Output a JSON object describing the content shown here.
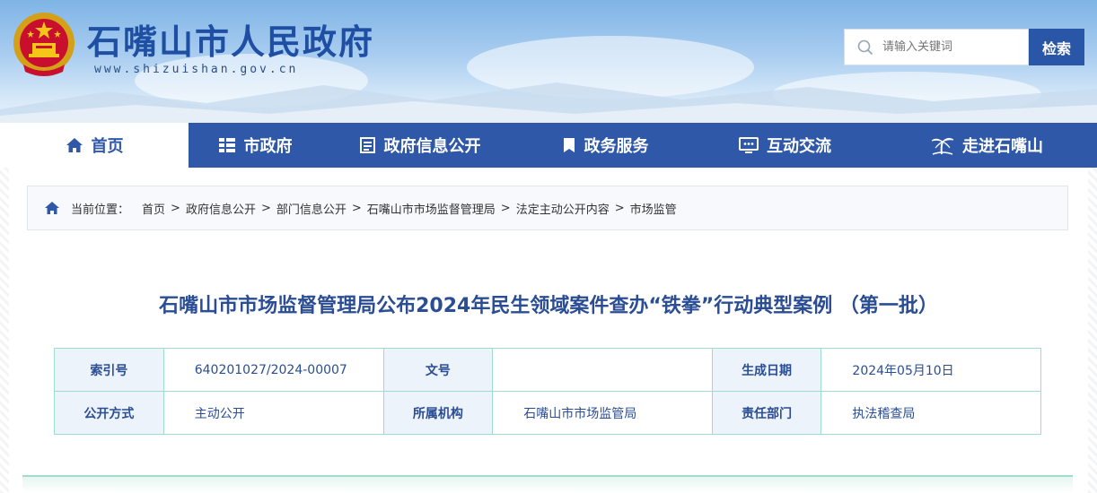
{
  "header": {
    "site_title": "石嘴山市人民政府",
    "site_url": "www.shizuishan.gov.cn",
    "emblem_icon": "national-emblem-icon",
    "search": {
      "placeholder": "请输入关键词",
      "button_label": "检索",
      "icon": "search-icon"
    }
  },
  "nav": {
    "items": [
      {
        "label": "首页",
        "icon": "home-icon",
        "active": true
      },
      {
        "label": "市政府",
        "icon": "grid-list-icon",
        "active": false
      },
      {
        "label": "政府信息公开",
        "icon": "document-list-icon",
        "active": false
      },
      {
        "label": "政务服务",
        "icon": "bookmark-icon",
        "active": false
      },
      {
        "label": "互动交流",
        "icon": "monitor-chat-icon",
        "active": false
      },
      {
        "label": "走进石嘴山",
        "icon": "palm-tree-icon",
        "active": false
      }
    ]
  },
  "breadcrumb": {
    "label": "当前位置：",
    "items": [
      "首页",
      "政府信息公开",
      "部门信息公开",
      "石嘴山市市场监督管理局",
      "法定主动公开内容",
      "市场监管"
    ],
    "separator": ">"
  },
  "article": {
    "title": "石嘴山市市场监督管理局公布2024年民生领域案件查办“铁拳”行动典型案例 （第一批）"
  },
  "meta": {
    "rows": [
      [
        {
          "key": "索引号",
          "value": "640201027/2024-00007"
        },
        {
          "key": "文号",
          "value": ""
        },
        {
          "key": "生成日期",
          "value": "2024年05月10日"
        }
      ],
      [
        {
          "key": "公开方式",
          "value": "主动公开"
        },
        {
          "key": "所属机构",
          "value": "石嘴山市市场监管局"
        },
        {
          "key": "责任部门",
          "value": "执法稽查局"
        }
      ]
    ]
  },
  "colors": {
    "primary": "#2f58a8",
    "title": "#2a4d94",
    "table_border": "#9fdccb",
    "key_bg": "#edf3fb"
  }
}
